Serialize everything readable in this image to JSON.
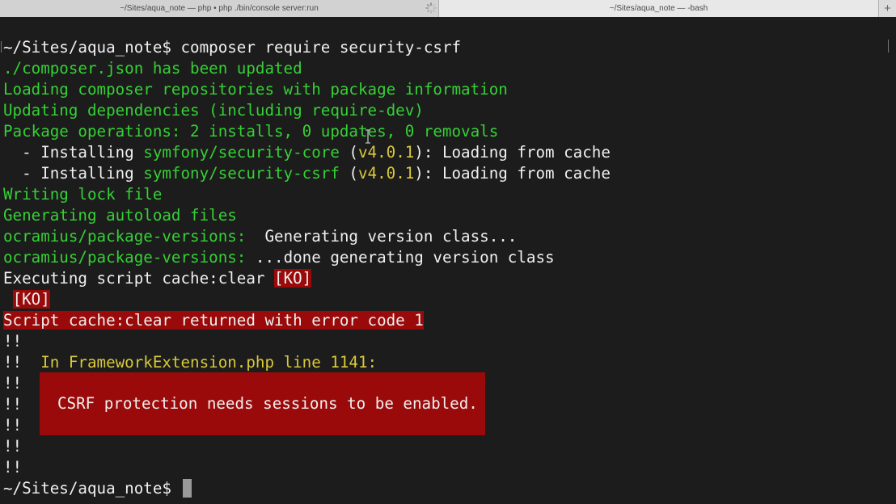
{
  "tabs": [
    {
      "title": "~/Sites/aqua_note — php • php ./bin/console server:run",
      "active": false,
      "loading": true
    },
    {
      "title": "~/Sites/aqua_note — -bash",
      "active": true
    }
  ],
  "new_tab_label": "+",
  "colors": {
    "background": "#1c1c1c",
    "green": "#35d135",
    "yellow": "#d8c93a",
    "error_bg": "#9b0a0a",
    "text": "#f0f0f0"
  },
  "terminal": {
    "line1": {
      "prompt": "~/Sites/aqua_note$",
      "command": " composer require security-csrf"
    },
    "line2": "./composer.json has been updated",
    "line3": "Loading composer repositories with package information",
    "line4": "Updating dependencies (including require-dev)",
    "line5": "Package operations: 2 installs, 0 updates, 0 removals",
    "line6": {
      "prefix": "  - Installing ",
      "package": "symfony/security-core",
      "open": " (",
      "version": "v4.0.1",
      "suffix": "): Loading from cache"
    },
    "line7": {
      "prefix": "  - Installing ",
      "package": "symfony/security-csrf",
      "open": " (",
      "version": "v4.0.1",
      "suffix": "): Loading from cache"
    },
    "line8": "Writing lock file",
    "line9": "Generating autoload files",
    "line10": {
      "source": "ocramius/package-versions:",
      "message": "  Generating version class..."
    },
    "line11": {
      "source": "ocramius/package-versions:",
      "message": " ...done generating version class"
    },
    "line12": {
      "text": "Executing script cache:clear ",
      "badge": "[KO]"
    },
    "line13": {
      "badge": "[KO]"
    },
    "line14": "Script cache:clear returned with error code 1",
    "bang": "!!",
    "line16_location": "In FrameworkExtension.php line 1141:",
    "error_message": "CSRF protection needs sessions to be enabled.",
    "final_prompt": "~/Sites/aqua_note$"
  }
}
